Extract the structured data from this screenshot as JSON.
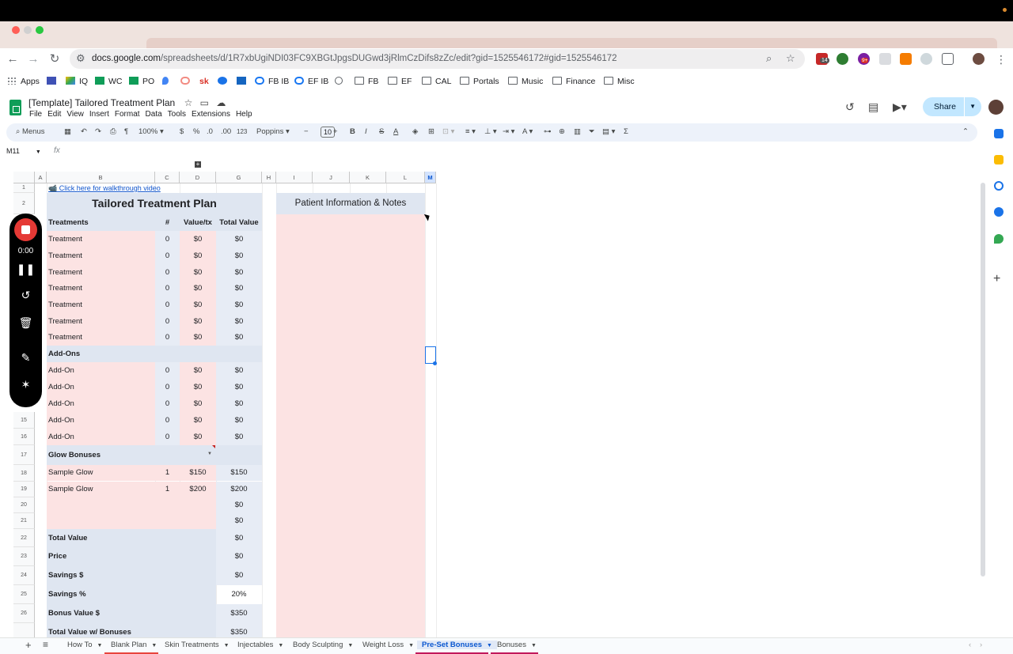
{
  "browser": {
    "url_host": "docs.google.com",
    "url_path": "/spreadsheets/d/1R7xbUgiNDI03FC9XBGtJpgsDUGwd3jRlmCzDifs8zZc/edit?gid=1525546172#gid=1525546172",
    "ext_badge_1": "14",
    "ext_badge_2": "9+"
  },
  "bookmarks": [
    "Apps",
    "IQ",
    "WC",
    "PO",
    "FB IB",
    "EF IB",
    "FB",
    "EF",
    "CAL",
    "Portals",
    "Music",
    "Finance",
    "Misc"
  ],
  "sheets": {
    "title": "[Template] Tailored Treatment Plan",
    "menu": [
      "File",
      "Edit",
      "View",
      "Insert",
      "Format",
      "Data",
      "Tools",
      "Extensions",
      "Help"
    ],
    "share_label": "Share",
    "toolbar": {
      "search": "Menus",
      "zoom": "100%",
      "currency": "$",
      "percent": "%",
      "dec_less": ".0",
      "dec_more": ".00",
      "number_format": "123",
      "font": "Poppins",
      "font_size": "10"
    },
    "name_box": "M11",
    "fx": "fx"
  },
  "grid": {
    "columns": [
      "A",
      "B",
      "C",
      "D",
      "G",
      "H",
      "I",
      "J",
      "K",
      "L",
      "M"
    ],
    "rows": [
      "1",
      "2",
      "15",
      "16",
      "17",
      "18",
      "19",
      "20",
      "21",
      "22",
      "23",
      "24",
      "25",
      "26"
    ],
    "link": "📹 Click here for walkthrough video",
    "title": "Tailored Treatment Plan",
    "notes_title": "Patient Information & Notes",
    "headers": [
      "Treatments",
      "#",
      "Value/tx",
      "Total Value"
    ],
    "treatments": [
      [
        "Treatment",
        "0",
        "$0",
        "$0"
      ],
      [
        "Treatment",
        "0",
        "$0",
        "$0"
      ],
      [
        "Treatment",
        "0",
        "$0",
        "$0"
      ],
      [
        "Treatment",
        "0",
        "$0",
        "$0"
      ],
      [
        "Treatment",
        "0",
        "$0",
        "$0"
      ],
      [
        "Treatment",
        "0",
        "$0",
        "$0"
      ],
      [
        "Treatment",
        "0",
        "$0",
        "$0"
      ]
    ],
    "addons_header": "Add-Ons",
    "addons": [
      [
        "Add-On",
        "0",
        "$0",
        "$0"
      ],
      [
        "Add-On",
        "0",
        "$0",
        "$0"
      ],
      [
        "Add-On",
        "0",
        "$0",
        "$0"
      ],
      [
        "Add-On",
        "0",
        "$0",
        "$0"
      ],
      [
        "Add-On",
        "0",
        "$0",
        "$0"
      ]
    ],
    "glow_header": "Glow Bonuses",
    "glow": [
      [
        "Sample Glow",
        "1",
        "$150",
        "$150"
      ],
      [
        "Sample Glow",
        "1",
        "$200",
        "$200"
      ],
      [
        "",
        "",
        "",
        "$0"
      ],
      [
        "",
        "",
        "",
        "$0"
      ]
    ],
    "summary": [
      [
        "Total Value",
        "$0"
      ],
      [
        "Price",
        "$0"
      ],
      [
        "Savings $",
        "$0"
      ],
      [
        "Savings %",
        "20%"
      ],
      [
        "Bonus Value $",
        "$350"
      ],
      [
        "Total Value w/ Bonuses",
        "$350"
      ]
    ]
  },
  "recorder": {
    "time": "0:00"
  },
  "sheet_tabs": [
    {
      "label": "How To",
      "color": ""
    },
    {
      "label": "Blank Plan",
      "color": "#e8453c"
    },
    {
      "label": "Skin Treatments",
      "color": ""
    },
    {
      "label": "Injectables",
      "color": ""
    },
    {
      "label": "Body Sculpting",
      "color": ""
    },
    {
      "label": "Weight Loss",
      "color": ""
    },
    {
      "label": "Pre-Set Bonuses",
      "color": "#c2185b"
    },
    {
      "label": "Bonuses",
      "color": "#c2185b"
    }
  ]
}
